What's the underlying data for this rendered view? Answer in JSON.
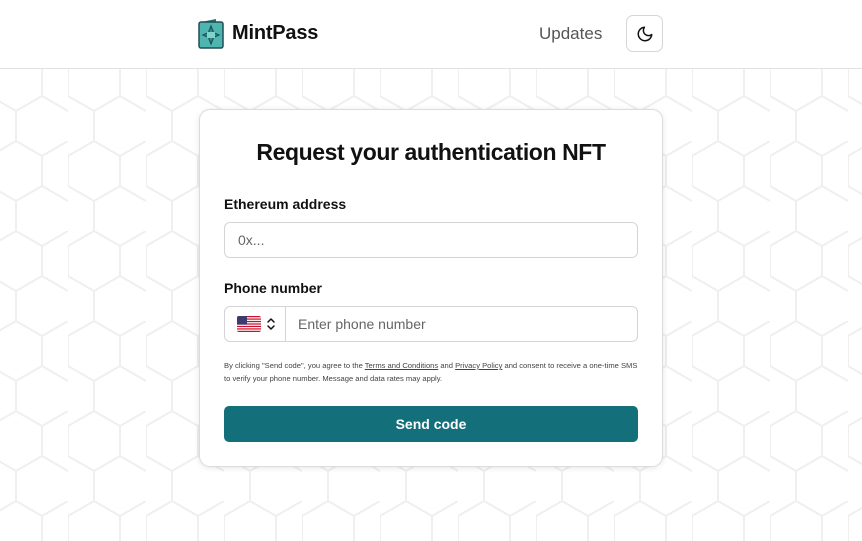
{
  "header": {
    "brand_name": "MintPass",
    "brand_logo_icon": "mintpass-logo-icon",
    "nav_updates_label": "Updates",
    "theme_toggle_icon": "moon-icon"
  },
  "form": {
    "title": "Request your authentication NFT",
    "eth_label": "Ethereum address",
    "eth_placeholder": "0x...",
    "eth_value": "",
    "phone_label": "Phone number",
    "country_flag_icon": "us-flag-icon",
    "country_select_icon": "chevron-up-down-icon",
    "phone_placeholder": "Enter phone number",
    "phone_value": "",
    "consent_part1": "By clicking \"Send code\", you agree to the ",
    "terms_link": "Terms and Conditions",
    "consent_part2": " and ",
    "privacy_link": "Privacy Policy",
    "consent_part3": " and consent to receive a one-time SMS to verify your phone number. Message and data rates may apply.",
    "submit_label": "Send code"
  },
  "colors": {
    "accent": "#13707b",
    "logo_teal": "#4fb5b0",
    "background": "#ffffff",
    "hex_pattern": "#f0f0f0"
  }
}
